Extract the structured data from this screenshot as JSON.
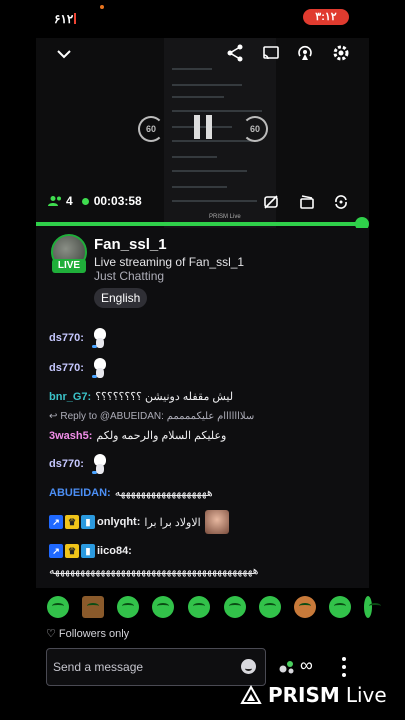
{
  "status_bar": {
    "left_text": "۶۱۲",
    "clock": "۳:۱۲"
  },
  "player": {
    "skip_back": "60",
    "skip_forward": "60",
    "viewers": "4",
    "elapsed": "00:03:58",
    "watermark": "PRISM Live",
    "progress": 0.99
  },
  "stream": {
    "channel": "Fan_ssl_1",
    "live_badge": "LIVE",
    "title": "Live streaming of Fan_ssl_1",
    "category": "Just Chatting",
    "tag": "English"
  },
  "chat": {
    "messages": [
      {
        "user": "ds770:",
        "text": "",
        "emote": "cat-emote"
      },
      {
        "user": "ds770:",
        "text": "",
        "emote": "cat-emote"
      },
      {
        "user": "bnr_G7:",
        "text": "ليش مقفله دونيشن ؟؟؟؟؟؟؟؟"
      },
      {
        "reply": "Reply to @ABUEIDAN: سلااااااام عليكممممم"
      },
      {
        "user": "3wash5:",
        "text": "وعليكم السلام والرحمه ولكم"
      },
      {
        "user": "ds770:",
        "text": "",
        "emote": "cat-emote"
      },
      {
        "user": "ABUEIDAN:",
        "text": "ههههههههههههههههههه"
      },
      {
        "user": "onlyqht:",
        "text": "الاولاد برا برا"
      },
      {
        "user": "iico84:",
        "text": ""
      },
      {
        "continuation": "ههههههههههههههههههههههههههههههههههههههههه"
      }
    ]
  },
  "followers_only": "Followers only",
  "input": {
    "placeholder": "Send a message"
  },
  "branding": {
    "prism": "PRISM",
    "live": "Live"
  }
}
